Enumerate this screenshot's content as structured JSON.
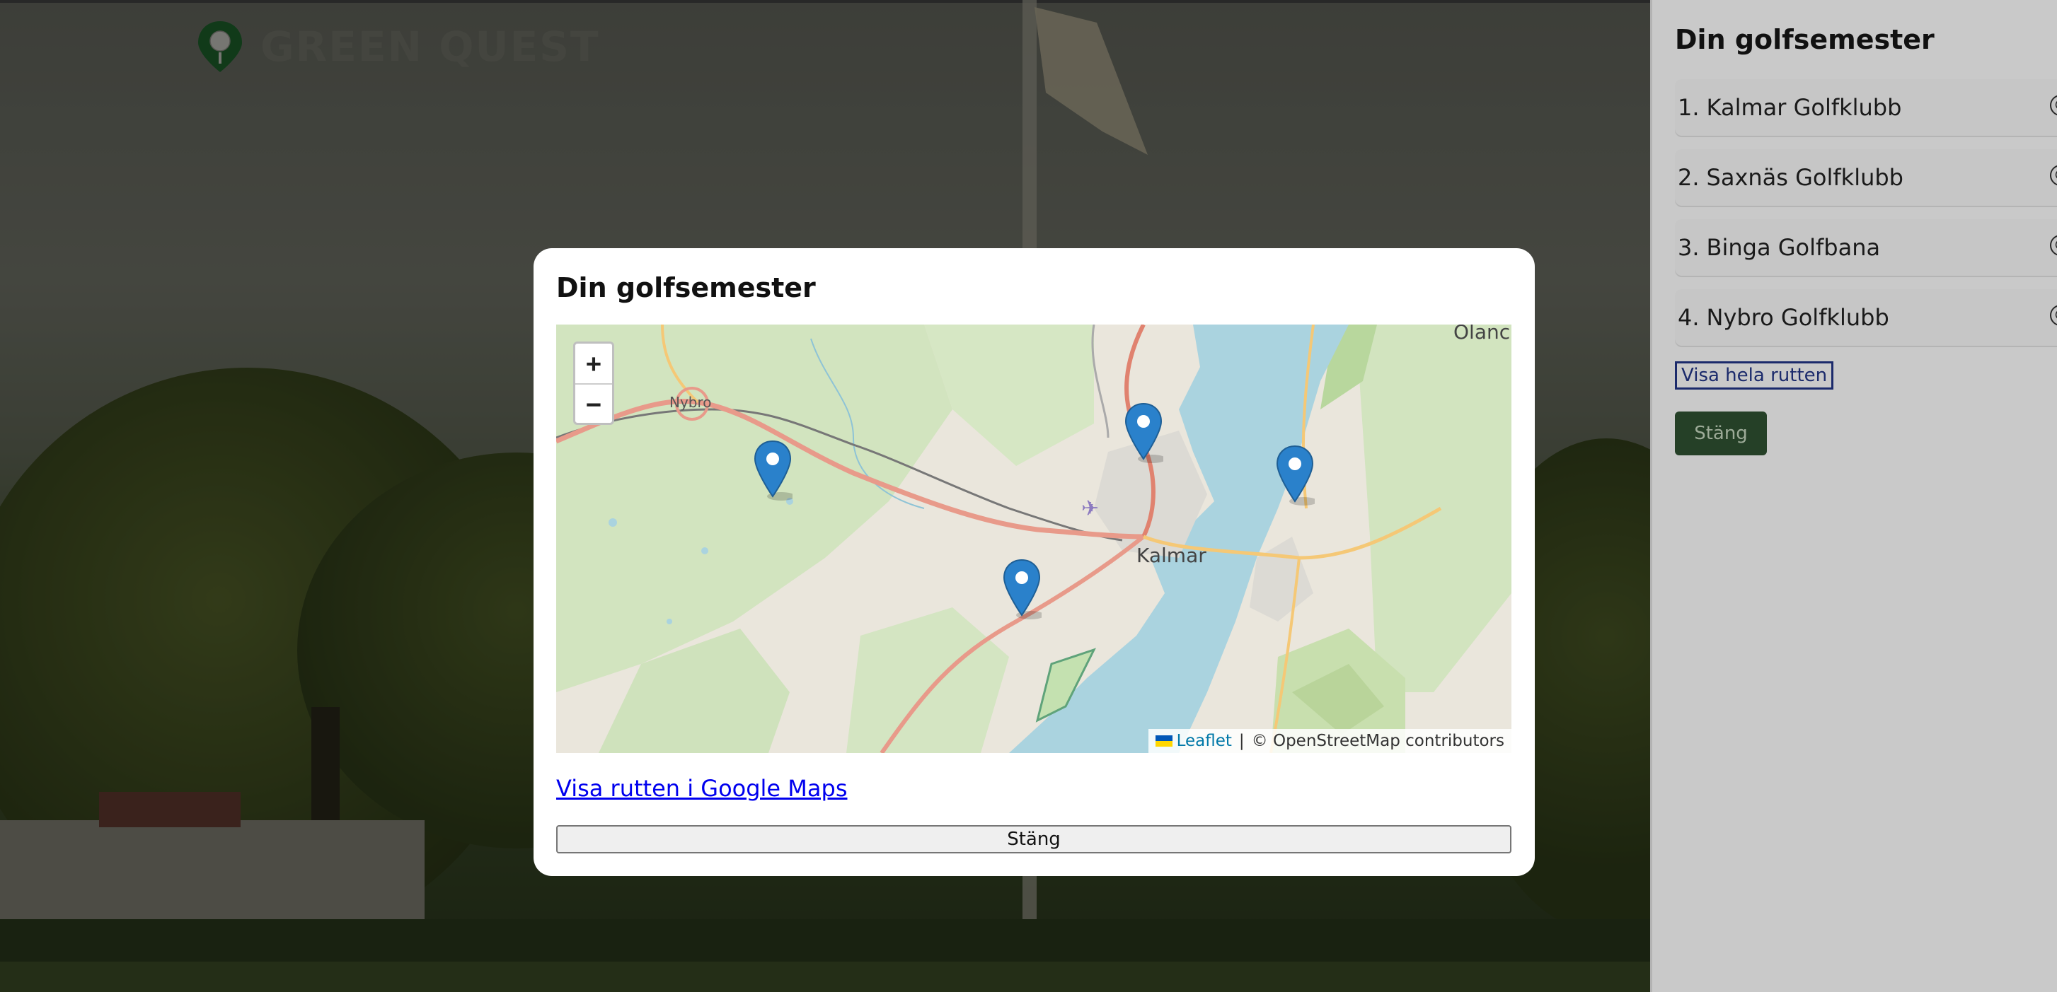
{
  "brand": {
    "name": "GREEN QUEST"
  },
  "panel": {
    "title": "Din golfsemester",
    "items": [
      {
        "num": "1.",
        "name": "Kalmar Golfklubb"
      },
      {
        "num": "2.",
        "name": "Saxnäs Golfklubb"
      },
      {
        "num": "3.",
        "name": "Binga Golfbana"
      },
      {
        "num": "4.",
        "name": "Nybro Golfklubb"
      }
    ],
    "remove_icon": "⊗",
    "show_route_label": "Visa hela rutten",
    "close_label": "Stäng"
  },
  "modal": {
    "title": "Din golfsemester",
    "map": {
      "zoom_in": "+",
      "zoom_out": "−",
      "labels": {
        "nybro": "Nybro",
        "kalmar": "Kalmar",
        "oland": "Ölanc"
      },
      "attribution": {
        "leaflet": "Leaflet",
        "separator": "|",
        "osm": "© OpenStreetMap contributors"
      },
      "marker_count": 4
    },
    "gmaps_link": "Visa rutten i Google Maps",
    "close_label": "Stäng"
  },
  "colors": {
    "marker": "#2a81cb",
    "accent_dark": "#254027",
    "link": "#0000ee"
  }
}
